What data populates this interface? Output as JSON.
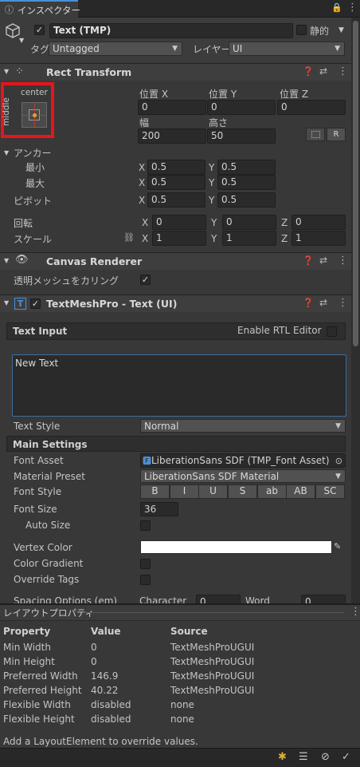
{
  "tab": {
    "title": "インスペクター"
  },
  "object": {
    "name": "Text (TMP)",
    "static_label": "静的",
    "tag_label": "タグ",
    "tag_value": "Untagged",
    "layer_label": "レイヤー",
    "layer_value": "UI"
  },
  "rect_transform": {
    "title": "Rect Transform",
    "anchor_preset_top": "center",
    "anchor_preset_side": "middle",
    "pos_x_label": "位置 X",
    "pos_y_label": "位置 Y",
    "pos_z_label": "位置 Z",
    "pos_x": "0",
    "pos_y": "0",
    "pos_z": "0",
    "width_label": "幅",
    "height_label": "高さ",
    "width": "200",
    "height": "50",
    "r_button": "R",
    "anchors_label": "アンカー",
    "min_label": "最小",
    "max_label": "最大",
    "pivot_label": "ピボット",
    "x_label": "X",
    "y_label": "Y",
    "z_label": "Z",
    "min_x": "0.5",
    "min_y": "0.5",
    "max_x": "0.5",
    "max_y": "0.5",
    "pivot_x": "0.5",
    "pivot_y": "0.5",
    "rotation_label": "回転",
    "rot_x": "0",
    "rot_y": "0",
    "rot_z": "0",
    "scale_label": "スケール",
    "scale_x": "1",
    "scale_y": "1",
    "scale_z": "1"
  },
  "canvas_renderer": {
    "title": "Canvas Renderer",
    "cull_label": "透明メッシュをカリング"
  },
  "tmp": {
    "title": "TextMeshPro - Text (UI)",
    "text_input_label": "Text Input",
    "rtl_label": "Enable RTL Editor",
    "text_value": "New Text",
    "text_style_label": "Text Style",
    "text_style_value": "Normal",
    "main_settings_label": "Main Settings",
    "font_asset_label": "Font Asset",
    "font_asset_value": "LiberationSans SDF (TMP_Font Asset)",
    "material_preset_label": "Material Preset",
    "material_preset_value": "LiberationSans SDF Material",
    "font_style_label": "Font Style",
    "font_style_buttons": [
      "B",
      "I",
      "U",
      "S",
      "ab",
      "AB",
      "SC"
    ],
    "font_size_label": "Font Size",
    "font_size_value": "36",
    "auto_size_label": "Auto Size",
    "vertex_color_label": "Vertex Color",
    "color_gradient_label": "Color Gradient",
    "override_tags_label": "Override Tags",
    "spacing_label": "Spacing Options (em)",
    "character_label": "Character",
    "character_value": "0",
    "word_label": "Word",
    "word_value": "0"
  },
  "layout": {
    "title": "レイアウトプロパティ",
    "col_property": "Property",
    "col_value": "Value",
    "col_source": "Source",
    "rows": [
      {
        "property": "Min Width",
        "value": "0",
        "source": "TextMeshProUGUI"
      },
      {
        "property": "Min Height",
        "value": "0",
        "source": "TextMeshProUGUI"
      },
      {
        "property": "Preferred Width",
        "value": "146.9",
        "source": "TextMeshProUGUI"
      },
      {
        "property": "Preferred Height",
        "value": "40.22",
        "source": "TextMeshProUGUI"
      },
      {
        "property": "Flexible Width",
        "value": "disabled",
        "source": "none"
      },
      {
        "property": "Flexible Height",
        "value": "disabled",
        "source": "none"
      }
    ],
    "footer_hint": "Add a LayoutElement to override values."
  },
  "colors": {
    "highlight_box": "#e8141c",
    "panel_bg": "#383838",
    "header_bg": "#3e3e3e",
    "accent_blue": "#4a90d9"
  }
}
